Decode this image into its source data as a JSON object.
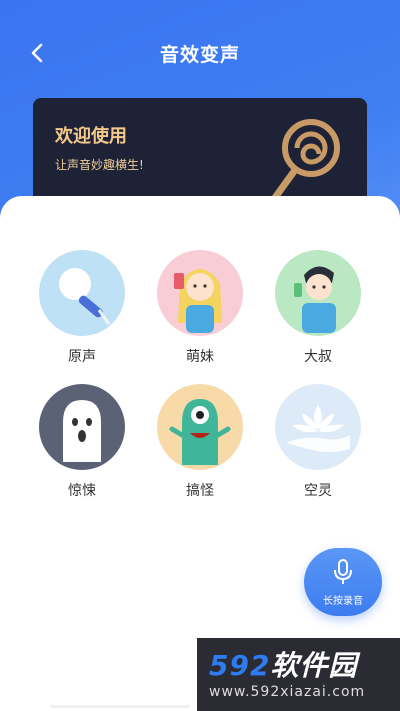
{
  "header": {
    "title": "音效变声",
    "back_icon": "chevron-left-icon"
  },
  "banner": {
    "title": "欢迎使用",
    "subtitle": "让声音妙趣横生!",
    "art_icon": "lollipop-icon"
  },
  "effects": [
    {
      "label": "原声",
      "icon": "microphone-icon",
      "bg": "#bfe1f6"
    },
    {
      "label": "萌妹",
      "icon": "girl-icon",
      "bg": "#f8cdd5"
    },
    {
      "label": "大叔",
      "icon": "man-icon",
      "bg": "#b9e8c2"
    },
    {
      "label": "惊悚",
      "icon": "ghost-icon",
      "bg": "#5b6275"
    },
    {
      "label": "搞怪",
      "icon": "monster-icon",
      "bg": "#f8d9a8"
    },
    {
      "label": "空灵",
      "icon": "lotus-icon",
      "bg": "#dcebf7"
    }
  ],
  "record_button": {
    "label": "长按录音",
    "icon": "microphone-icon"
  },
  "watermark": {
    "logo_number": "592",
    "logo_text": "软件园",
    "url": "www.592xiazai.com"
  },
  "colors": {
    "primary": "#3f7af0",
    "banner_bg": "#1d2236",
    "banner_gold": "#f4c98a"
  }
}
